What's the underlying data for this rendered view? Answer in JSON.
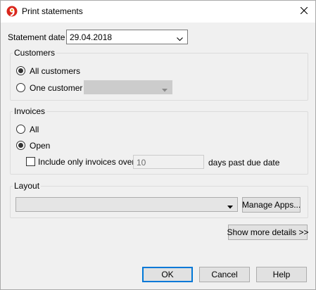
{
  "window": {
    "title": "Print statements",
    "close_icon": "close-icon"
  },
  "statement_date": {
    "label": "Statement date",
    "value": "29.04.2018"
  },
  "customers": {
    "title": "Customers",
    "all_label": "All customers",
    "one_label": "One customer",
    "selected": "all",
    "customer_value": ""
  },
  "invoices": {
    "title": "Invoices",
    "all_label": "All",
    "open_label": "Open",
    "selected": "open",
    "include_only_label": "Include only invoices over",
    "include_only_checked": false,
    "days_value": "10",
    "days_suffix": "days past due date"
  },
  "layout": {
    "title": "Layout",
    "layout_value": "",
    "manage_apps_label": "Manage Apps..."
  },
  "show_more_label": "Show more details >>",
  "buttons": {
    "ok": "OK",
    "cancel": "Cancel",
    "help": "Help"
  },
  "colors": {
    "accent": "#0078d7",
    "logo_red": "#d9261c",
    "logo_orange": "#f39200"
  }
}
